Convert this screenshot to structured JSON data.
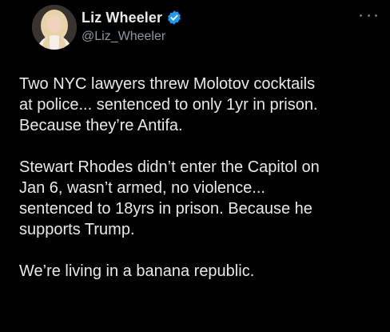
{
  "author": {
    "display_name": "Liz Wheeler",
    "handle": "@Liz_Wheeler",
    "verified": true
  },
  "icons": {
    "verified": "verified-badge-icon",
    "more": "more-options-icon"
  },
  "colors": {
    "background": "#000000",
    "text": "#e7e9ea",
    "secondary_text": "#8b98a5",
    "verified_blue": "#1d9bf0"
  },
  "tweet": {
    "paragraphs": [
      "Two NYC lawyers threw Molotov cocktails\nat police... sentenced to only 1yr in prison.\nBecause they’re Antifa.",
      "Stewart Rhodes didn’t enter the Capitol on\nJan 6, wasn’t armed, no violence...\nsentenced to 18yrs in prison. Because he\nsupports Trump.",
      "We’re living in a banana republic."
    ]
  }
}
